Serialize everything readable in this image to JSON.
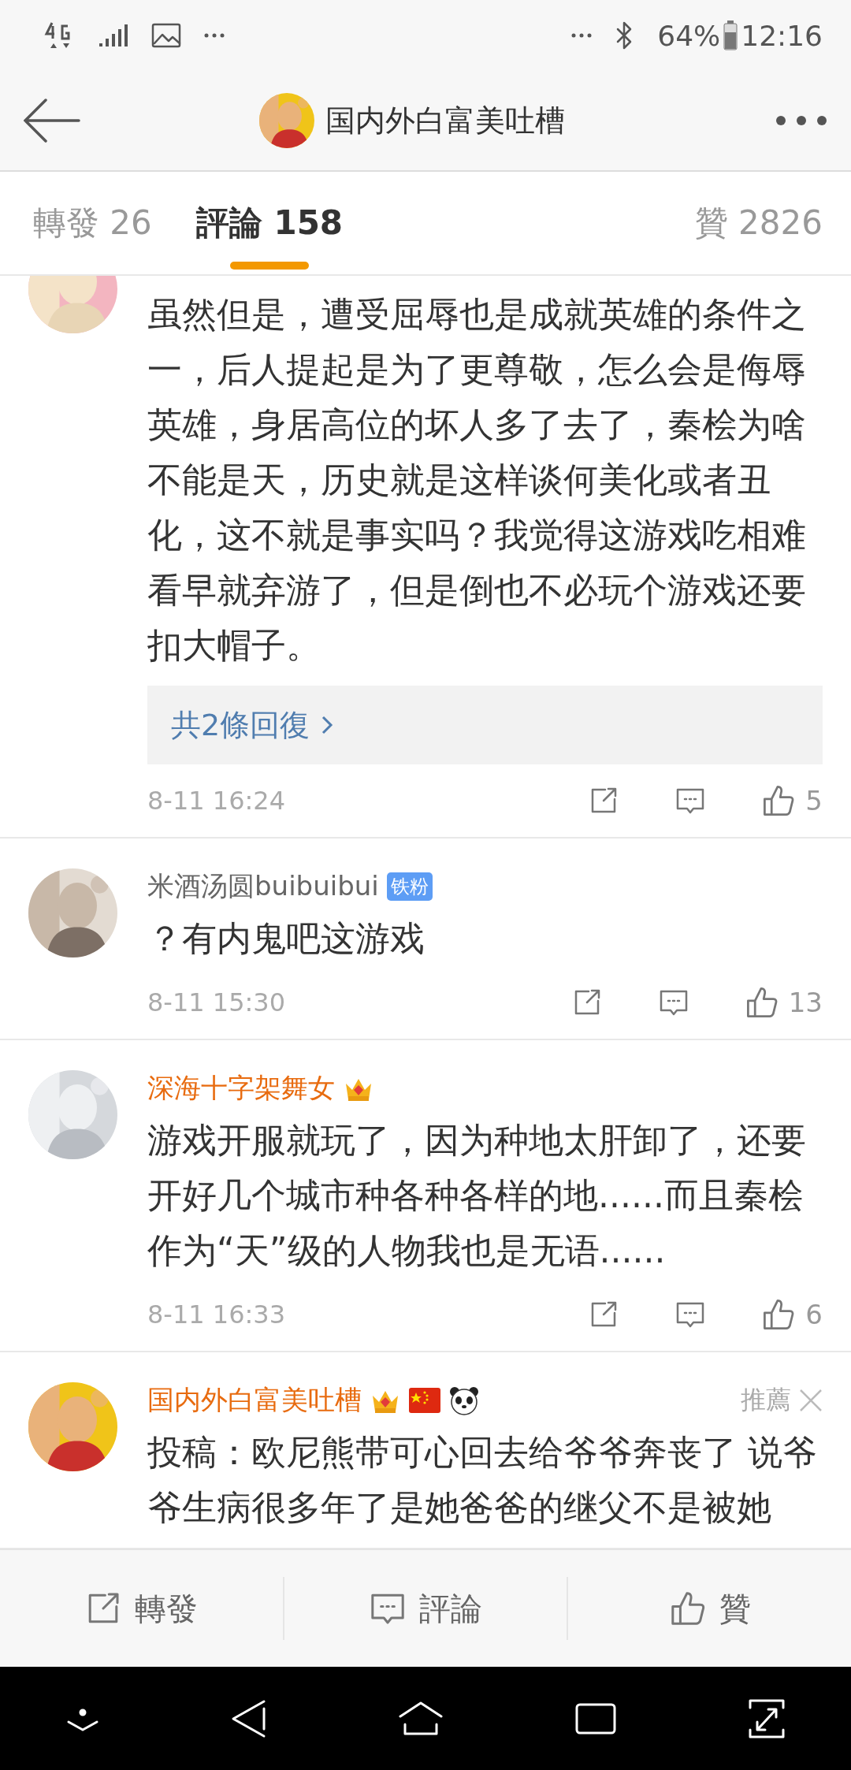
{
  "status_bar": {
    "battery": "64%",
    "time": "12:16"
  },
  "header": {
    "title": "国内外白富美吐槽",
    "avatar": {
      "kind": "picture"
    }
  },
  "tabs": [
    {
      "label": "轉發 26",
      "selected": false
    },
    {
      "label": "評論 158",
      "selected": true
    },
    {
      "label": "贊 2826",
      "selected": false
    }
  ],
  "comments": [
    {
      "avatar": {
        "kind": "picture"
      },
      "text": "虽然但是，遭受屈辱也是成就英雄的条件之一，后人提起是为了更尊敬，怎么会是侮辱英雄，身居高位的坏人多了去了，秦桧为啥不能是天，历史就是这样谈何美化或者丑化，这不就是事实吗？我觉得这游戏吃相难看早就弃游了，但是倒也不必玩个游戏还要扣大帽子。",
      "replies": "共2條回復",
      "date": "8-11 16:24",
      "likes": "5"
    },
    {
      "avatar": {
        "kind": "picture"
      },
      "name": "米酒汤圆buibuibui",
      "vip": false,
      "badges": [
        {
          "kind": "fan",
          "label": "铁粉"
        }
      ],
      "text": "？有内鬼吧这游戏",
      "date": "8-11 15:30",
      "likes": "13"
    },
    {
      "avatar": {
        "kind": "picture"
      },
      "name": "深海十字架舞女",
      "vip": true,
      "badges": [
        {
          "kind": "crown"
        }
      ],
      "text": "游戏开服就玩了，因为种地太肝卸了，还要开好几个城市种各种各样的地......而且秦桧作为“天”级的人物我也是无语......",
      "date": "8-11 16:33",
      "likes": "6"
    },
    {
      "avatar": {
        "kind": "picture"
      },
      "name": "国内外白富美吐槽",
      "vip": true,
      "badges": [
        {
          "kind": "crown"
        },
        {
          "kind": "flag"
        },
        {
          "kind": "panda"
        }
      ],
      "recommend": "推薦",
      "text": "投稿：欧尼熊带可心回去给爷爷奔丧了 说爷爷生病很多年了是她爸爸的继父不是被她"
    }
  ],
  "bottom_bar": [
    {
      "kind": "share",
      "label": "轉發"
    },
    {
      "kind": "comment",
      "label": "評論"
    },
    {
      "kind": "like",
      "label": "贊"
    }
  ]
}
